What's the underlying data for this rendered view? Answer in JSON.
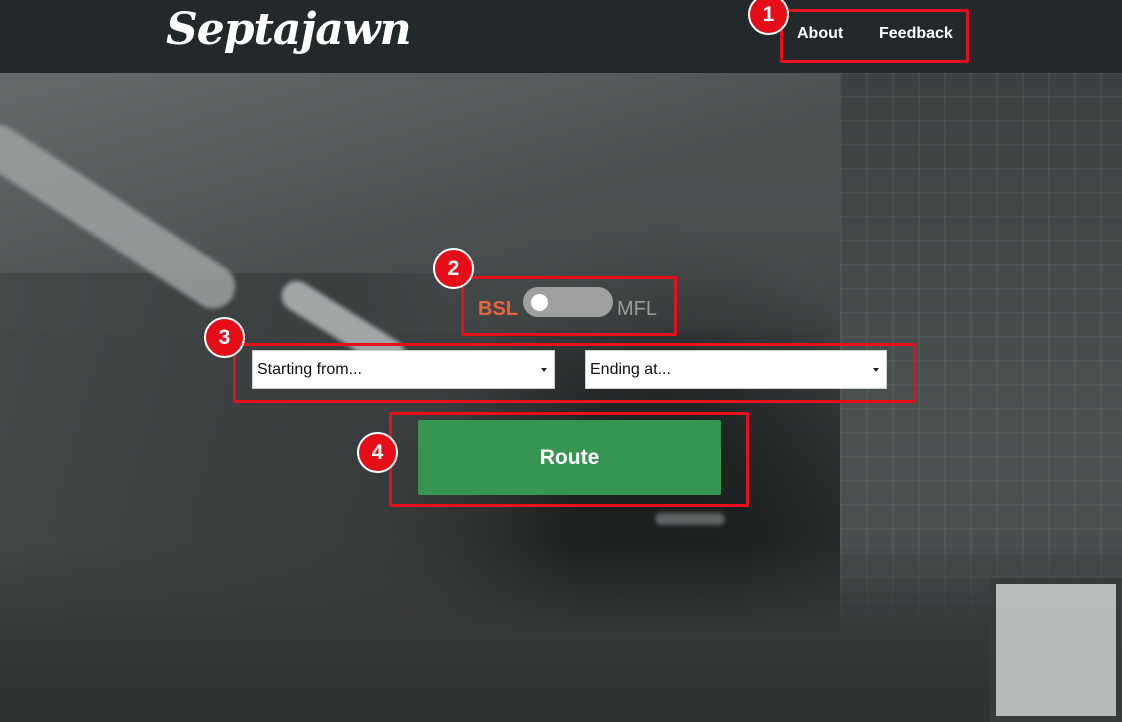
{
  "header": {
    "logo_text": "Septajawn",
    "nav": {
      "about_label": "About",
      "feedback_label": "Feedback"
    }
  },
  "line_toggle": {
    "left_label": "BSL",
    "right_label": "MFL",
    "selected": "BSL",
    "left_color": "#e8643a",
    "right_color": "#9b9b9b"
  },
  "route_form": {
    "start_select": {
      "selected": "Starting from..."
    },
    "end_select": {
      "selected": "Ending at..."
    },
    "route_button_label": "Route",
    "button_color": "#379552"
  },
  "annotations": {
    "color": "#e50d18",
    "badges": [
      "1",
      "2",
      "3",
      "4"
    ]
  },
  "icons": {
    "select_arrow": "caret-down-icon"
  }
}
